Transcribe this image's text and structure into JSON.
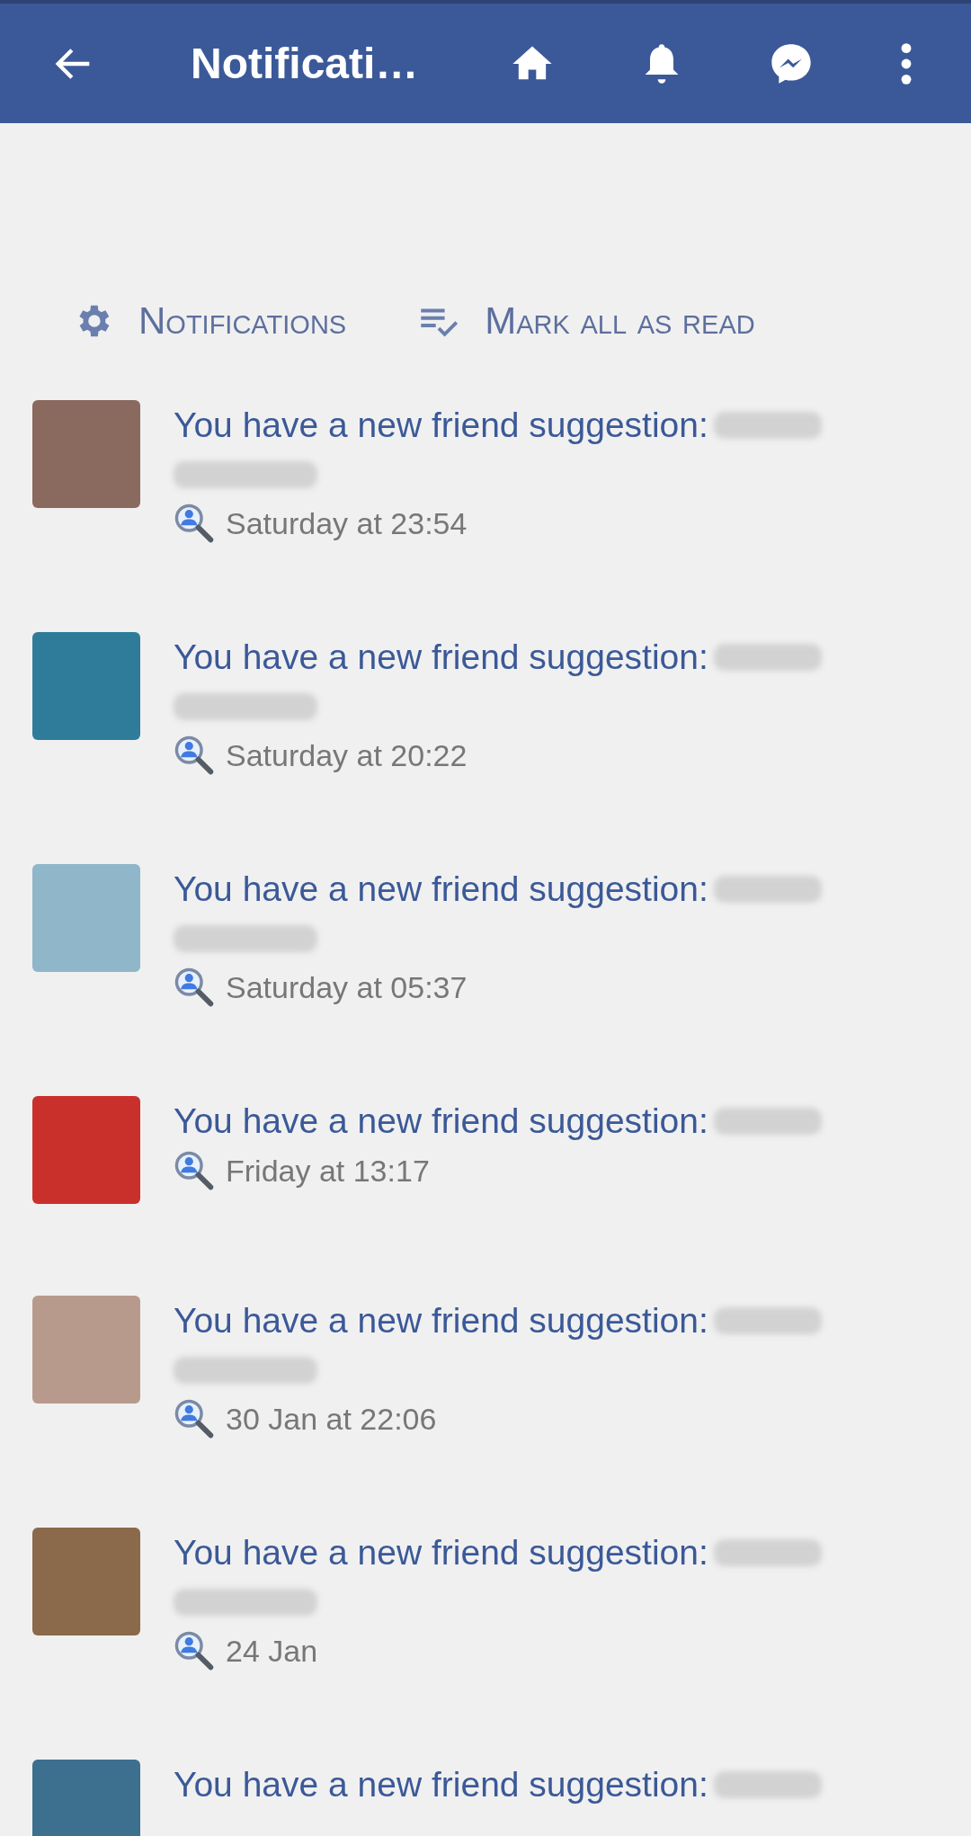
{
  "app_bar": {
    "title": "Notificati…"
  },
  "actions": [
    {
      "kind": "settings",
      "label": "Notifications"
    },
    {
      "kind": "mark-read",
      "label": "Mark all as read"
    }
  ],
  "notifications": [
    {
      "text": "You have a new friend suggestion:",
      "name_wraps": true,
      "time": "Saturday at 23:54",
      "color": "#8a6a5e"
    },
    {
      "text": "You have a new friend suggestion:",
      "name_wraps": true,
      "time": "Saturday at 20:22",
      "color": "#2f7c9a"
    },
    {
      "text": "You have a new friend suggestion:",
      "name_wraps": true,
      "time": "Saturday at 05:37",
      "color": "#8fb6c9"
    },
    {
      "text": "You have a new friend suggestion:",
      "name_wraps": false,
      "time": "Friday at 13:17",
      "color": "#c9302c"
    },
    {
      "text": "You have a new friend suggestion:",
      "name_wraps": true,
      "time": "30 Jan at 22:06",
      "color": "#b89a8c"
    },
    {
      "text": "You have a new friend suggestion:",
      "name_wraps": true,
      "time": "24 Jan",
      "color": "#8a6a4a"
    },
    {
      "text": "You have a new friend suggestion:",
      "name_wraps": false,
      "color": "#3d6f8e"
    }
  ]
}
